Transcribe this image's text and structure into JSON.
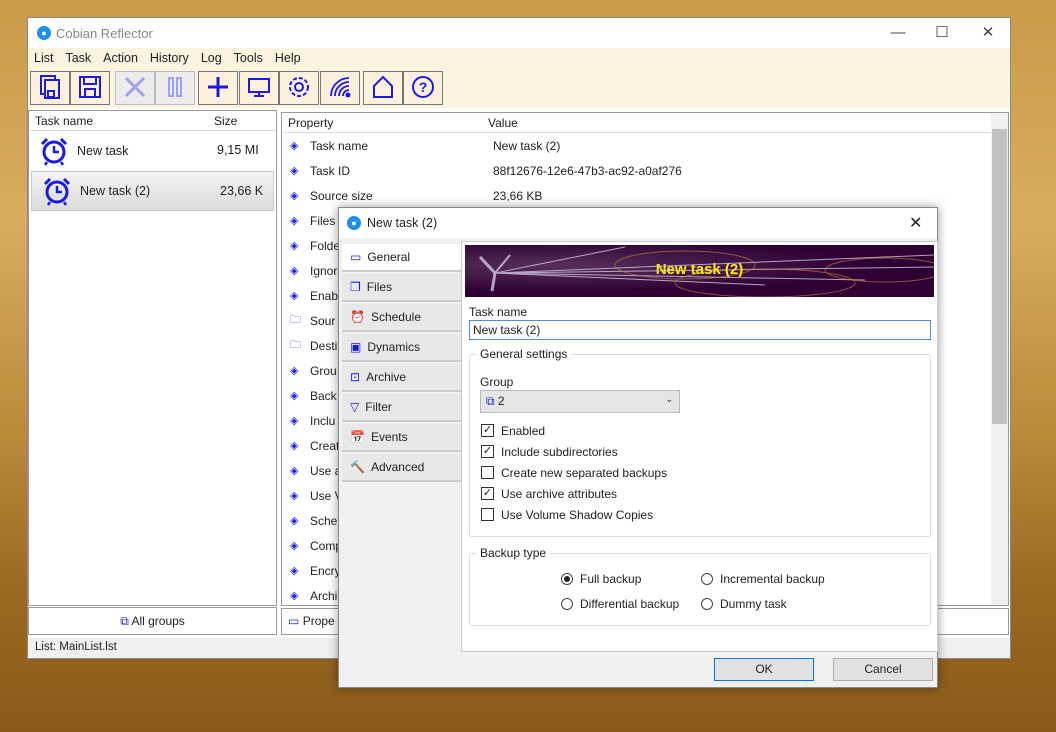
{
  "window": {
    "title": "Cobian Reflector",
    "controls": [
      "—",
      "☐",
      "✕"
    ]
  },
  "menu": [
    "List",
    "Task",
    "Action",
    "History",
    "Log",
    "Tools",
    "Help"
  ],
  "toolbar": [
    {
      "icon": "save-list-icon",
      "enabled": true
    },
    {
      "icon": "save-icon",
      "enabled": true
    },
    {
      "icon": "delete-icon",
      "enabled": false
    },
    {
      "icon": "pause-icon",
      "enabled": false
    },
    {
      "icon": "add-icon",
      "enabled": true
    },
    {
      "icon": "monitor-icon",
      "enabled": true
    },
    {
      "icon": "gear-icon",
      "enabled": true
    },
    {
      "icon": "signal-icon",
      "enabled": true
    },
    {
      "icon": "home-icon",
      "enabled": true
    },
    {
      "icon": "help-icon",
      "enabled": true
    }
  ],
  "tasklist": {
    "headers": [
      "Task name",
      "Size"
    ],
    "rows": [
      {
        "name": "New task",
        "size": "9,15 MI"
      },
      {
        "name": "New task (2)",
        "size": "23,66 K",
        "selected": true
      }
    ],
    "footer": "All groups"
  },
  "properties": {
    "headers": [
      "Property",
      "Value"
    ],
    "rows": [
      {
        "p": "Task name",
        "v": "New task (2)"
      },
      {
        "p": "Task ID",
        "v": "88f12676-12e6-47b3-ac92-a0af276"
      },
      {
        "p": "Source size",
        "v": "23,66 KB"
      },
      {
        "p": "Files",
        "v": ""
      },
      {
        "p": "Folde",
        "v": ""
      },
      {
        "p": "Ignor",
        "v": ""
      },
      {
        "p": "Enab",
        "v": ""
      },
      {
        "p": "Sour",
        "v": "",
        "folder": true
      },
      {
        "p": "Desti",
        "v": "",
        "folder": true
      },
      {
        "p": "Grou",
        "v": ""
      },
      {
        "p": "Back",
        "v": ""
      },
      {
        "p": "Inclu",
        "v": ""
      },
      {
        "p": "Creat",
        "v": ""
      },
      {
        "p": "Use a",
        "v": ""
      },
      {
        "p": "Use V",
        "v": ""
      },
      {
        "p": "Sche",
        "v": ""
      },
      {
        "p": "Comp",
        "v": ""
      },
      {
        "p": "Encry",
        "v": ""
      },
      {
        "p": "Archi",
        "v": ""
      }
    ],
    "footer": "Prope"
  },
  "status": "List: MainList.lst",
  "dialog": {
    "title": "New task (2)",
    "banner": "New task (2)",
    "tabs": [
      "General",
      "Files",
      "Schedule",
      "Dynamics",
      "Archive",
      "Filter",
      "Events",
      "Advanced"
    ],
    "task_name_label": "Task name",
    "task_name_value": "New task (2)",
    "general_settings": "General settings",
    "group_label": "Group",
    "group_value": "2",
    "checks": [
      {
        "label": "Enabled",
        "checked": true
      },
      {
        "label": "Include subdirectories",
        "checked": true
      },
      {
        "label": "Create new separated backups",
        "checked": false
      },
      {
        "label": "Use archive attributes",
        "checked": true
      },
      {
        "label": "Use Volume Shadow Copies",
        "checked": false
      }
    ],
    "backup_type": "Backup type",
    "radios": [
      "Full backup",
      "Incremental backup",
      "Differential backup",
      "Dummy task"
    ],
    "selected_radio": "Full backup",
    "ok": "OK",
    "cancel": "Cancel"
  },
  "colors": {
    "accent": "#1a1ae6",
    "toolbar_bg": "#fdf3e1",
    "banner_bg": "#2e0033",
    "banner_text": "#ffee00"
  }
}
